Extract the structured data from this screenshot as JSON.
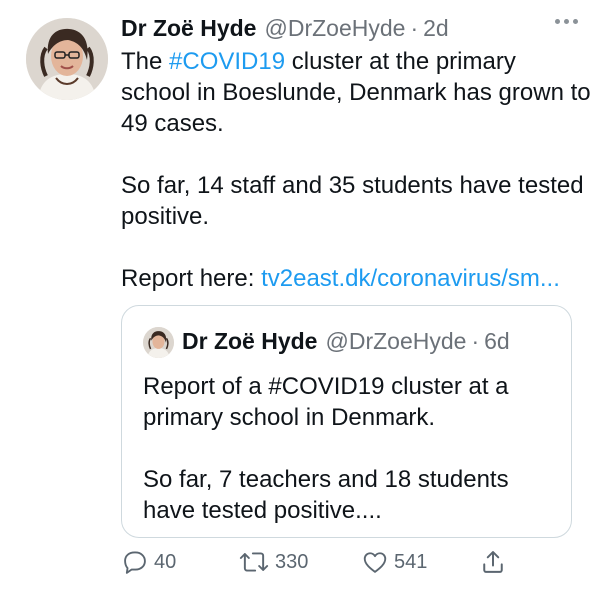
{
  "tweet": {
    "author_name": "Dr Zoë Hyde",
    "handle": "@DrZoeHyde",
    "separator": "·",
    "time": "2d",
    "text_part1": "The ",
    "hashtag": "#COVID19",
    "text_part2": " cluster at the primary school in Boeslunde, Denmark has grown to 49 cases.",
    "text_para2": "So far, 14 staff and 35 students have tested positive.",
    "report_prefix": "Report here: ",
    "report_link": "tv2east.dk/coronavirus/sm..."
  },
  "quoted": {
    "author_name": "Dr Zoë Hyde",
    "handle": "@DrZoeHyde",
    "separator": "·",
    "time": "6d",
    "text_para1": "Report of a #COVID19 cluster at a primary school in Denmark.",
    "text_para2": "So far, 7 teachers and 18 students have tested positive...."
  },
  "actions": {
    "replies": "40",
    "retweets": "330",
    "likes": "541"
  },
  "colors": {
    "link": "#1d9bf0",
    "muted": "#6b7178",
    "border": "#cfd9de"
  }
}
